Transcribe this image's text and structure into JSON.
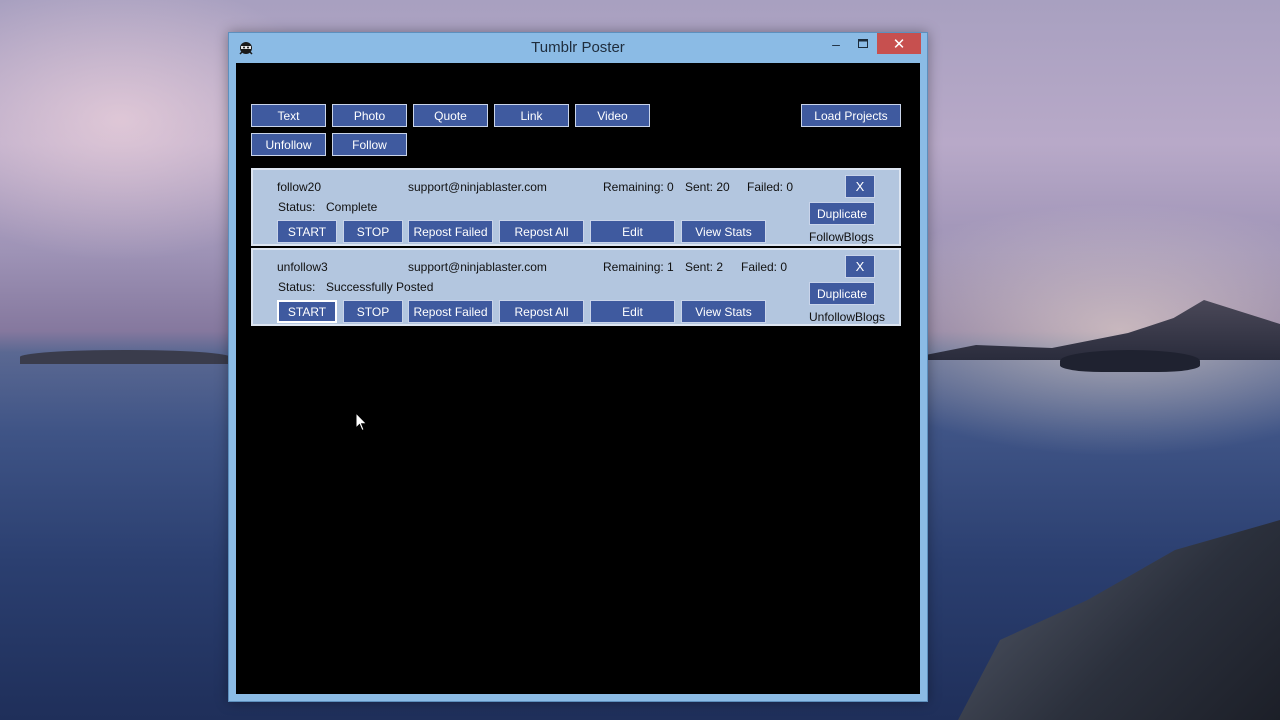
{
  "window": {
    "title": "Tumblr Poster"
  },
  "toolbar": {
    "row1": [
      "Text",
      "Photo",
      "Quote",
      "Link",
      "Video"
    ],
    "row2": [
      "Unfollow",
      "Follow"
    ],
    "load_projects": "Load Projects"
  },
  "projects": [
    {
      "name": "follow20",
      "email": "support@ninjablaster.com",
      "remaining": "Remaining: 0",
      "sent": "Sent: 20",
      "failed": "Failed: 0",
      "status_label": "Status:",
      "status_value": "Complete",
      "type": "FollowBlogs",
      "buttons": {
        "start": "START",
        "stop": "STOP",
        "repost_failed": "Repost Failed",
        "repost_all": "Repost All",
        "edit": "Edit",
        "view_stats": "View Stats",
        "duplicate": "Duplicate",
        "close": "X"
      }
    },
    {
      "name": "unfollow3",
      "email": "support@ninjablaster.com",
      "remaining": "Remaining: 1",
      "sent": "Sent: 2",
      "failed": "Failed: 0",
      "status_label": "Status:",
      "status_value": "Successfully Posted",
      "type": "UnfollowBlogs",
      "buttons": {
        "start": "START",
        "stop": "STOP",
        "repost_failed": "Repost Failed",
        "repost_all": "Repost All",
        "edit": "Edit",
        "view_stats": "View Stats",
        "duplicate": "Duplicate",
        "close": "X"
      }
    }
  ],
  "icons": {
    "app": "ninja-icon",
    "minimize": "minimize-icon",
    "maximize": "maximize-icon",
    "close": "close-icon",
    "cursor": "mouse-pointer-icon"
  },
  "colors": {
    "button_bg": "#3f5a9f",
    "panel_bg": "#b3c6df",
    "window_frame": "#8bbbe5",
    "close_red": "#c7504f"
  }
}
